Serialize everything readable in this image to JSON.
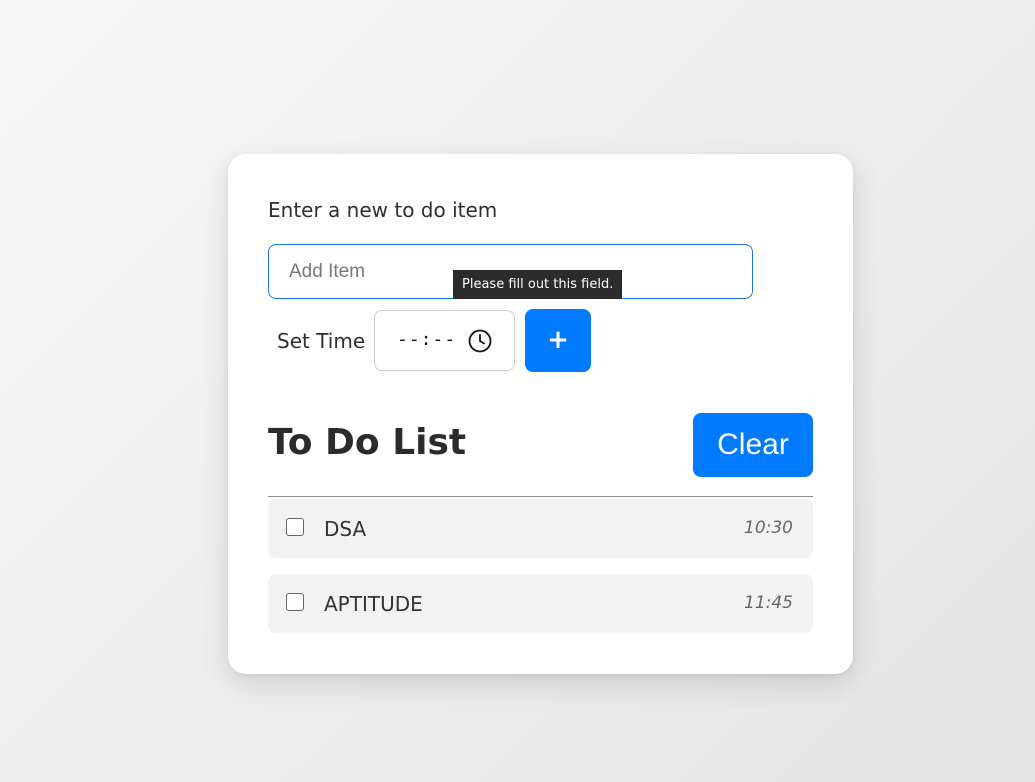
{
  "form": {
    "label": "Enter a new to do item",
    "item_input": {
      "value": "",
      "placeholder": "Add Item"
    },
    "validation_tooltip": "Please fill out this field.",
    "time_label": "Set Time",
    "time_input": {
      "display": "--:--",
      "icon": "clock-icon"
    },
    "add_button_label": "+"
  },
  "list": {
    "title": "To Do List",
    "clear_button_label": "Clear",
    "items": [
      {
        "text": "DSA",
        "time": "10:30",
        "checked": false
      },
      {
        "text": "APTITUDE",
        "time": "11:45",
        "checked": false
      }
    ]
  },
  "colors": {
    "accent": "#007bff",
    "input_focus_border": "#1a73e8",
    "item_background": "#f2f2f2",
    "tooltip_background": "#2b2b2b"
  }
}
